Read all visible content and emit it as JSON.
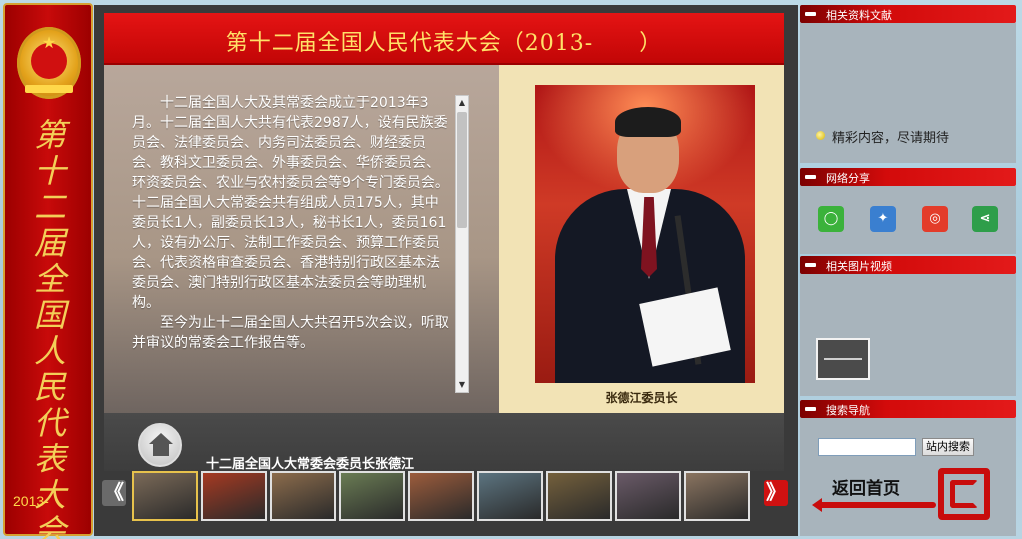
{
  "left_banner": {
    "vertical_title": "第十二届全国人民代表大会",
    "year": "2013-"
  },
  "main": {
    "title": "第十二届全国人民代表大会（2013-　　）",
    "article": [
      "十二届全国人大及其常委会成立于2013年3月。十二届全国人大共有代表2987人，设有民族委员会、法律委员会、内务司法委员会、财经委员会、教科文卫委员会、外事委员会、华侨委员会、环资委员会、农业与农村委员会等9个专门委员会。十二届全国人大常委会共有组成人员175人，其中委员长1人，副委员长13人，秘书长1人，委员161人，设有办公厅、法制工作委员会、预算工作委员会、代表资格审查委员会、香港特别行政区基本法委员会、澳门特别行政区基本法委员会等助理机构。",
      "至今为止十二届全国人大共召开5次会议，听取并审议的常委会工作报告等。"
    ],
    "photo_caption": "张德江委员长",
    "info_text": "十二届全国人大常委会委员长张德江",
    "nav_prev": "《",
    "nav_next": "》",
    "thumbnails": [
      {
        "color": "#7b6a58"
      },
      {
        "color": "#a63a22"
      },
      {
        "color": "#8c6c4c"
      },
      {
        "color": "#6a7c54"
      },
      {
        "color": "#9c5c3c"
      },
      {
        "color": "#5c7480"
      },
      {
        "color": "#74603c"
      },
      {
        "color": "#6a5a68"
      },
      {
        "color": "#8a7460"
      }
    ]
  },
  "sidebar": {
    "related_docs": {
      "label": "相关资料文献",
      "note": "精彩内容，尽请期待"
    },
    "share": {
      "label": "网络分享",
      "icons": [
        "wechat-icon",
        "qzone-icon",
        "weibo-icon",
        "share-icon"
      ]
    },
    "media": {
      "label": "相关图片视频"
    },
    "search": {
      "label": "搜索导航",
      "input_value": "",
      "button_label": "站内搜索",
      "home_label": "返回首页"
    }
  },
  "colors": {
    "banner_red": "#c80a0a",
    "title_gold": "#ffe168",
    "panel_cream": "#f2e3b5",
    "sidebar_panel": "#a8b4bc"
  }
}
